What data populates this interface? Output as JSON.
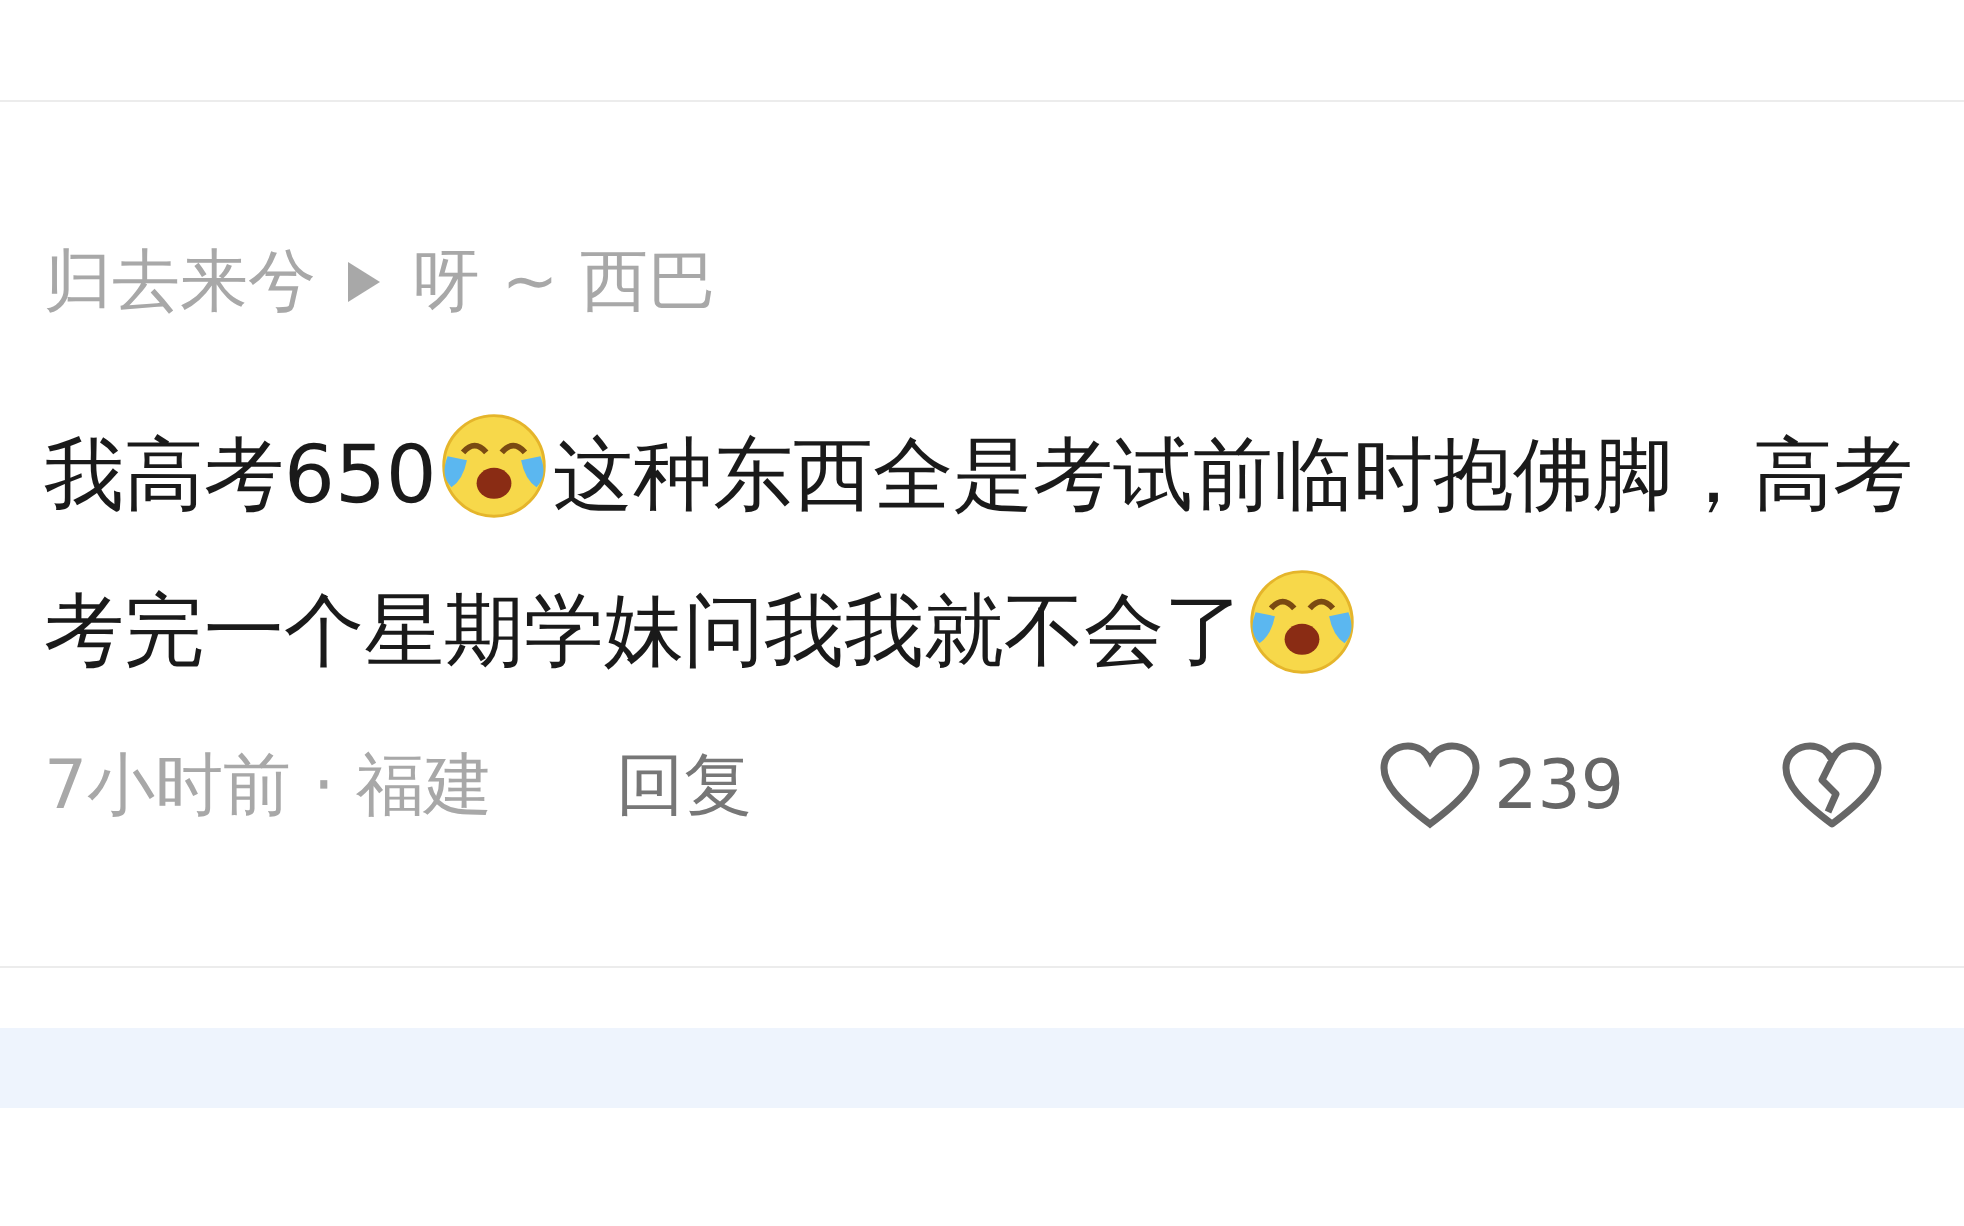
{
  "comment": {
    "author": "归去来兮",
    "reply_to": "呀 ~ 西巴",
    "body": [
      {
        "kind": "text",
        "text": "我高考650"
      },
      {
        "kind": "emoji"
      },
      {
        "kind": "text",
        "text": "这种东西全是考试前临时抱佛脚，高考考完一个星期学妹问我我就不会了"
      },
      {
        "kind": "emoji"
      }
    ],
    "meta": "7小时前 · 福建",
    "reply_label": "回复",
    "likes": "239",
    "liked": false
  }
}
